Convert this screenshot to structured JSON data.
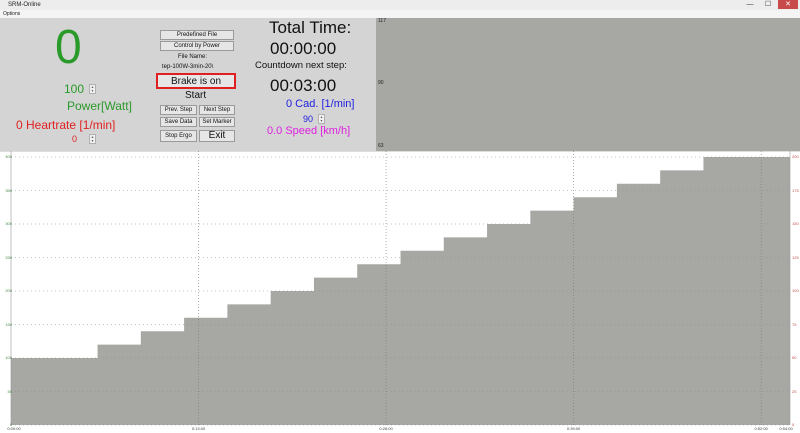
{
  "window": {
    "title": "SRM-Online",
    "minimize": "—",
    "maximize": "☐",
    "close": "✕"
  },
  "menu": {
    "options": "Options"
  },
  "left_panel": {
    "power_value": "0",
    "power_target": "100",
    "power_label": "Power[Watt]",
    "heartrate_label": "0 Heartrate [1/min]",
    "heartrate_target": "0"
  },
  "control_panel": {
    "predefined_file": "Predefined File",
    "control_by_power": "Control by Power",
    "file_name_label": "File Name:",
    "file_name_value": "tep-100W-3min-20\\",
    "brake_status": "Brake is on",
    "start": "Start",
    "prev_step": "Prev. Step",
    "next_step": "Next Step",
    "save_data": "Save Data",
    "set_marker": "Set Marker",
    "stop_ergo": "Stop Ergo",
    "exit": "Exit"
  },
  "time_panel": {
    "total_time_label": "Total Time:",
    "total_time_value": "00:00:00",
    "countdown_label": "Countdown next step:",
    "countdown_value": "00:03:00",
    "cadence_label": "0 Cad. [1/min]",
    "cadence_target": "90",
    "speed_label": "0.0 Speed [km/h]"
  },
  "mini_chart": {
    "y_top": "117",
    "y_mid": "90",
    "y_bottom": "63"
  },
  "colors": {
    "power": "#2a9a2a",
    "heartrate": "#e02020",
    "cadence": "#2020e0",
    "speed": "#e020e0",
    "fill": "#a7a7a3",
    "brake_border": "#e02020"
  },
  "chart_data": {
    "type": "area",
    "x": [
      "0:00:00",
      "0:03:00",
      "0:06:00",
      "0:09:00",
      "0:12:00",
      "0:15:00",
      "0:18:00",
      "0:21:00",
      "0:24:00",
      "0:27:00",
      "0:30:00",
      "0:33:00",
      "0:36:00",
      "0:39:00",
      "0:42:00",
      "0:45:00",
      "0:48:00",
      "0:51:00",
      "0:54:00"
    ],
    "series": [
      {
        "values": [
          100,
          100,
          120,
          140,
          160,
          180,
          200,
          220,
          240,
          260,
          280,
          300,
          320,
          340,
          360,
          380,
          400,
          400,
          400
        ]
      }
    ],
    "ylim": [
      0,
      400
    ],
    "xlim": [
      "0:00:00",
      "0:54:00"
    ],
    "x_ticks": [
      "0:00:00",
      "0:13:00",
      "0:26:00",
      "0:39:00",
      "0:52:00",
      "0:54:00"
    ],
    "y_ticks_left": [
      "0",
      "50",
      "100",
      "150",
      "200",
      "250",
      "300",
      "350",
      "400"
    ],
    "y_ticks_right": [
      "0",
      "25",
      "50",
      "75",
      "100",
      "125",
      "150",
      "175",
      "200"
    ],
    "grid": true
  }
}
